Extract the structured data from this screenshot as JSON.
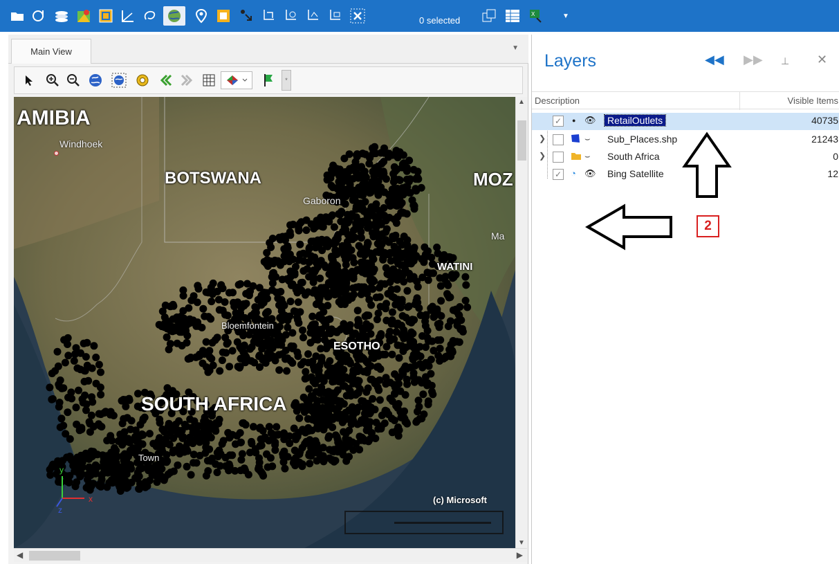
{
  "toolbar": {
    "icons": [
      "folder-icon",
      "layer-settings-icon",
      "layers-stack-icon",
      "map-marker-icon",
      "select-box-icon",
      "measure-icon",
      "lasso-icon",
      "globe-icon",
      "pin-icon",
      "frame-icon",
      "point-select-icon",
      "select-tool-1-icon",
      "select-tool-2-icon",
      "select-tool-3-icon",
      "select-tool-4-icon",
      "clear-selection-icon",
      "export-selection-icon",
      "table-icon",
      "excel-icon",
      "dropdown-icon"
    ],
    "selected_count_label": "0 selected"
  },
  "main_view": {
    "tab_label": "Main View",
    "map_tools": [
      "pointer-icon",
      "zoom-in-icon",
      "zoom-out-icon",
      "globe-full-extent-icon",
      "globe-layer-extent-icon",
      "settings-icon",
      "back-icon",
      "forward-icon",
      "grid-icon",
      "theme-icon",
      "legend-icon",
      "pin-icon"
    ]
  },
  "map": {
    "labels": {
      "namibia": "AMIBIA",
      "botswana": "BOTSWANA",
      "mozambique": "MOZ",
      "south_africa": "SOUTH AFRICA",
      "lesotho": "ESOTHO",
      "eswatini": "WATINI"
    },
    "cities": {
      "windhoek": "Windhoek",
      "gaborone": "Gaboron",
      "maputo": "Ma",
      "bloemfontein": "Bloemfontein",
      "cape_town": "Town"
    },
    "copyright": "(c) Microsoft",
    "axes": {
      "x": "x",
      "y": "y",
      "z": "z"
    }
  },
  "layers_panel": {
    "title": "Layers",
    "columns": {
      "description": "Description",
      "visible_items": "Visible Items"
    },
    "rows": [
      {
        "name": "RetailOutlets",
        "visible_items": "40735",
        "checked": true
      },
      {
        "name": "Sub_Places.shp",
        "visible_items": "21243",
        "checked": false
      },
      {
        "name": "South Africa",
        "visible_items": "0",
        "checked": false
      },
      {
        "name": "Bing Satellite",
        "visible_items": "12",
        "checked": true
      }
    ]
  },
  "annotation": {
    "step_badge": "2"
  },
  "colors": {
    "accent": "#1e73c8",
    "selection": "#0a1a8a",
    "badge": "#d92020"
  }
}
